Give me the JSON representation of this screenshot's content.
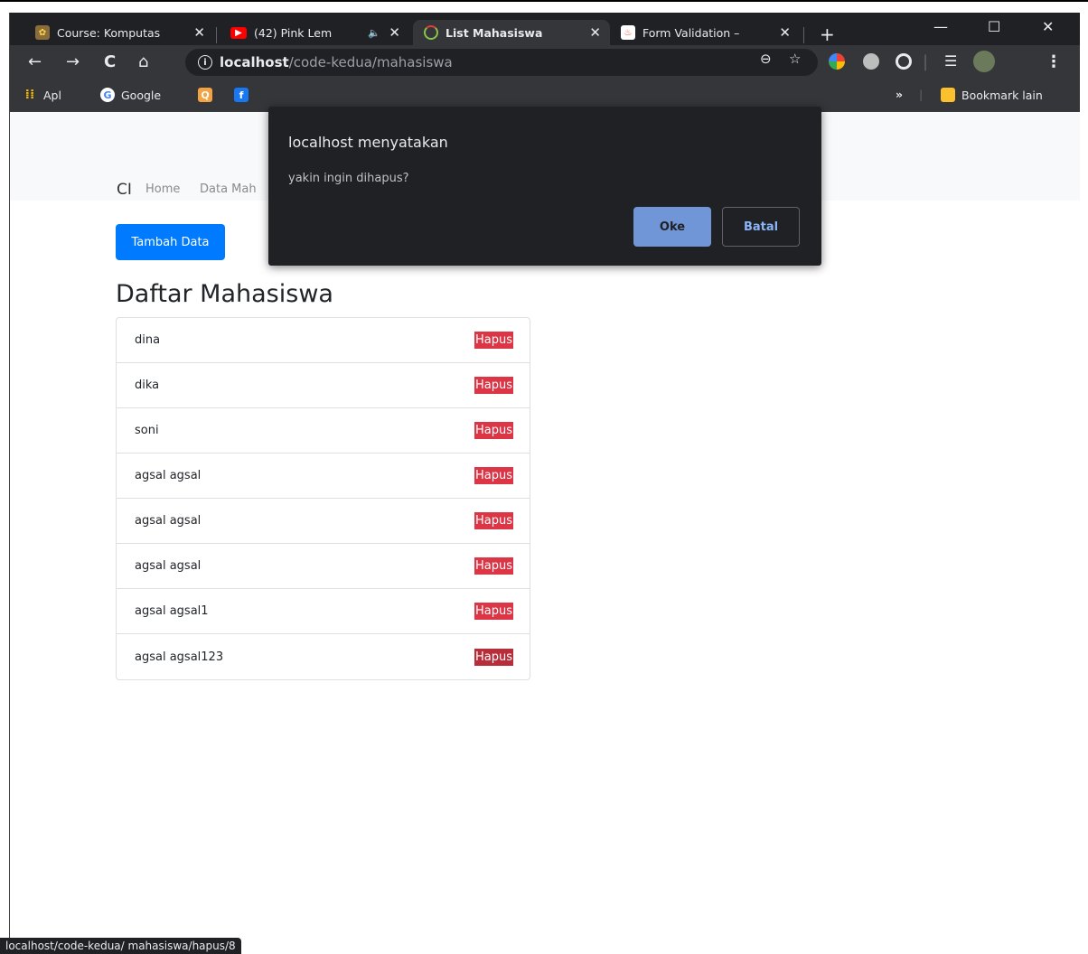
{
  "tabs": [
    {
      "title": "Course: Komputas",
      "active": false
    },
    {
      "title": "(42) Pink Lem",
      "active": false
    },
    {
      "title": "List Mahasiswa",
      "active": true
    },
    {
      "title": "Form Validation –",
      "active": false
    }
  ],
  "window_controls": {
    "minimize": "—",
    "maximize": "☐",
    "close": "✕"
  },
  "address_bar": {
    "host": "localhost",
    "path": "/code-kedua/mahasiswa"
  },
  "bookmarks": [
    {
      "label": "Apl"
    },
    {
      "label": "Google"
    },
    {
      "label": ""
    },
    {
      "label": ""
    }
  ],
  "bookmarks_other": "Bookmark lain",
  "navbar": {
    "brand": "CI",
    "links": [
      "Home",
      "Data Mah"
    ]
  },
  "page": {
    "add_button": "Tambah Data",
    "heading": "Daftar Mahasiswa",
    "delete_label": "Hapus",
    "students": [
      "dina",
      "dika",
      "soni",
      "agsal agsal",
      "agsal agsal",
      "agsal agsal",
      "agsal agsal1",
      "agsal agsal123"
    ]
  },
  "dialog": {
    "title": "localhost menyatakan",
    "message": "yakin ingin dihapus?",
    "ok_label": "Oke",
    "cancel_label": "Batal"
  },
  "status_url": "localhost/code-kedua/ mahasiswa/hapus/8"
}
